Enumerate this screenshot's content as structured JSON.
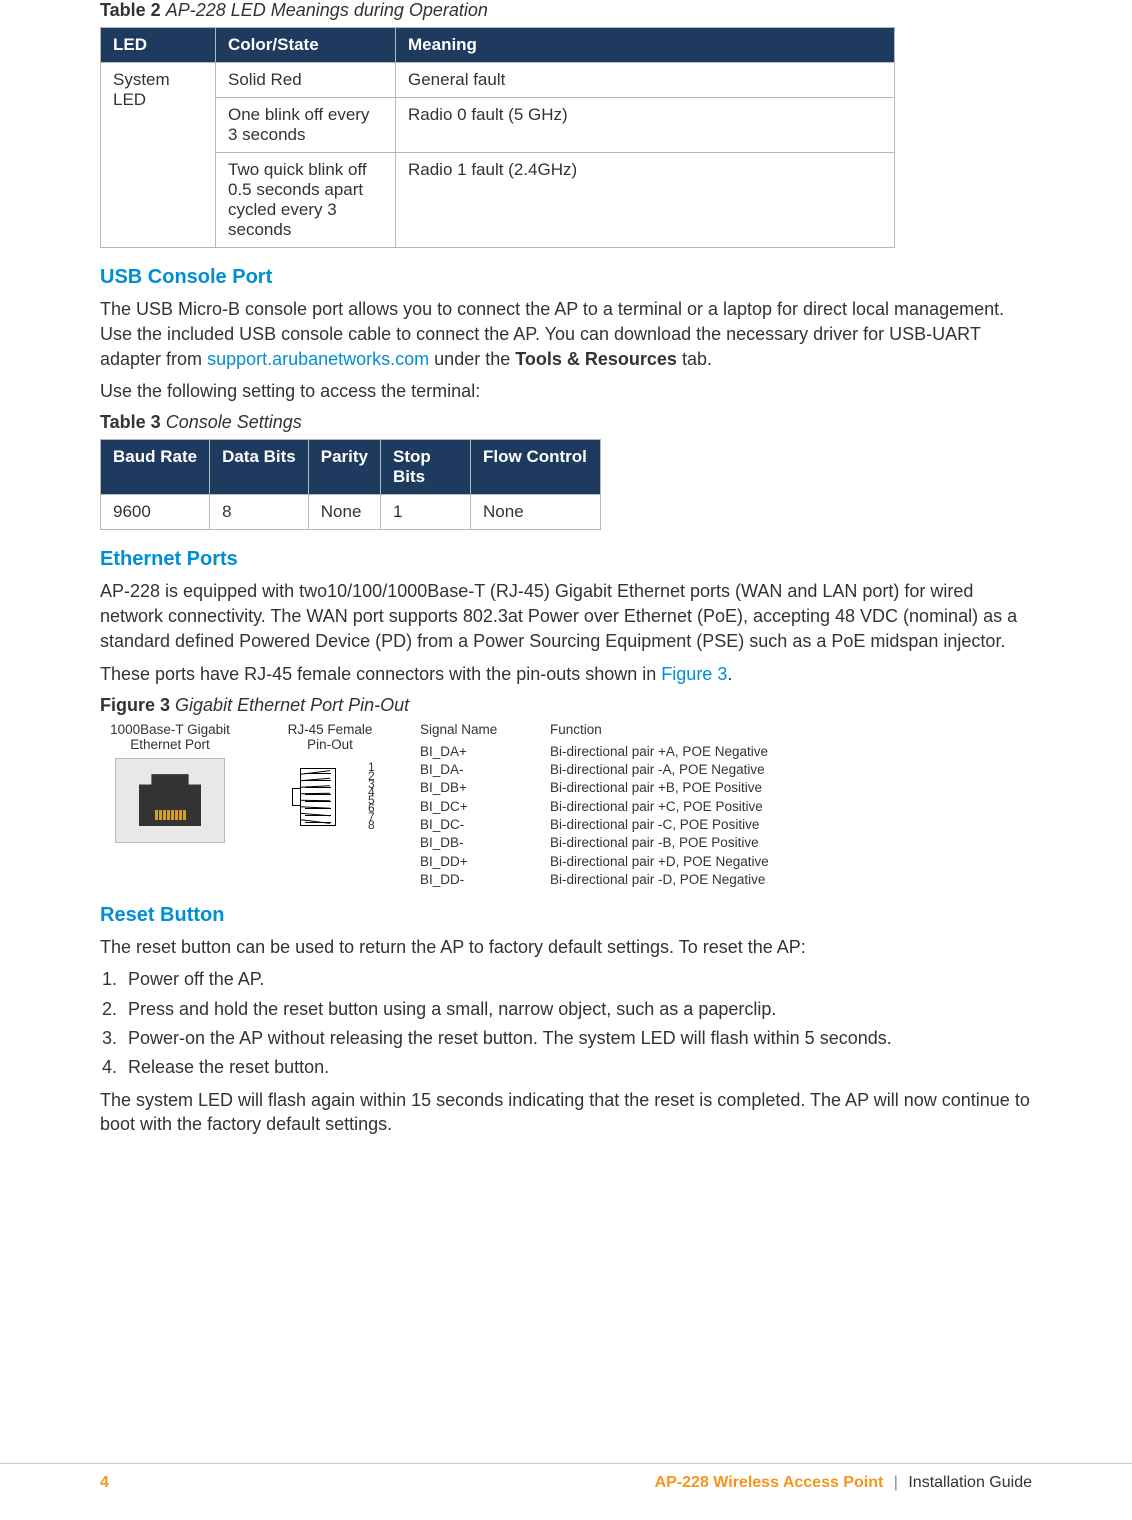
{
  "table2": {
    "caption_num": "Table 2",
    "caption_title": "AP-228 LED Meanings during Operation",
    "headers": [
      "LED",
      "Color/State",
      "Meaning"
    ],
    "led_group": "System LED",
    "rows": [
      {
        "state": "Solid Red",
        "meaning": "General fault"
      },
      {
        "state": "One blink off every 3 seconds",
        "meaning": "Radio 0 fault (5 GHz)"
      },
      {
        "state": "Two quick blink off 0.5 seconds apart cycled every 3 seconds",
        "meaning": "Radio 1 fault (2.4GHz)"
      }
    ]
  },
  "usb": {
    "heading": "USB Console Port",
    "para1_a": "The USB Micro-B console port allows you to connect the AP to a terminal or a laptop for direct local management. Use the included USB console cable to connect the AP. You can download the necessary driver for USB-UART adapter from ",
    "para1_link": "support.arubanetworks.com",
    "para1_b": " under the ",
    "para1_bold": "Tools & Resources",
    "para1_c": " tab.",
    "para2": "Use the following setting to access the terminal:"
  },
  "table3": {
    "caption_num": "Table 3",
    "caption_title": "Console Settings",
    "headers": [
      "Baud Rate",
      "Data Bits",
      "Parity",
      "Stop Bits",
      "Flow Control"
    ],
    "row": [
      "9600",
      "8",
      "None",
      "1",
      "None"
    ]
  },
  "eth": {
    "heading": "Ethernet Ports",
    "para1": "AP-228 is equipped with two10/100/1000Base-T (RJ-45) Gigabit Ethernet ports (WAN and LAN port) for wired network connectivity. The WAN port supports 802.3at Power over Ethernet (PoE), accepting 48 VDC (nominal) as a standard defined Powered Device (PD) from a Power Sourcing Equipment (PSE) such as a PoE midspan injector.",
    "para2_a": "These ports have RJ-45 female connectors with the pin-outs shown in ",
    "para2_link": "Figure 3",
    "para2_b": "."
  },
  "figure3": {
    "caption_num": "Figure 3",
    "caption_title": "Gigabit Ethernet Port Pin-Out",
    "col1_head": "1000Base-T Gigabit\nEthernet Port",
    "col2_head": "RJ-45 Female\nPin-Out",
    "col3_head": "Signal Name",
    "col4_head": "Function",
    "pins": [
      "1",
      "2",
      "3",
      "4",
      "5",
      "6",
      "7",
      "8"
    ],
    "signals": [
      "BI_DA+",
      "BI_DA-",
      "BI_DB+",
      "BI_DC+",
      "BI_DC-",
      "BI_DB-",
      "BI_DD+",
      "BI_DD-"
    ],
    "functions": [
      "Bi-directional pair +A, POE Negative",
      "Bi-directional pair -A, POE Negative",
      "Bi-directional pair +B, POE Positive",
      "Bi-directional pair +C, POE Positive",
      "Bi-directional pair -C, POE Positive",
      "Bi-directional pair -B, POE Positive",
      "Bi-directional pair +D, POE Negative",
      "Bi-directional pair -D, POE Negative"
    ]
  },
  "reset": {
    "heading": "Reset Button",
    "intro": "The reset button can be used to return the AP to factory default settings. To reset the AP:",
    "steps": [
      "Power off the AP.",
      "Press and hold the reset button using a small, narrow object, such as a paperclip.",
      "Power-on the AP without releasing the reset button. The system LED will flash within 5 seconds.",
      "Release the reset button."
    ],
    "outro": "The system LED will flash again within 15 seconds indicating that the reset is completed. The AP will now continue to boot with the factory default settings."
  },
  "footer": {
    "page": "4",
    "product": "AP-228 Wireless Access Point",
    "sep": "|",
    "doc": "Installation Guide"
  }
}
